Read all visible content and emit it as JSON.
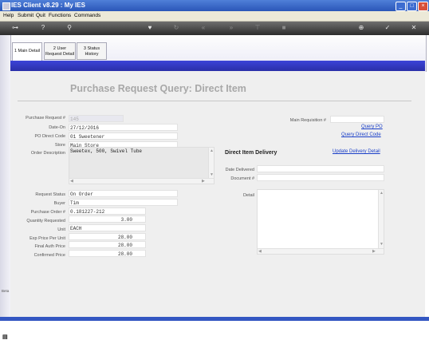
{
  "window": {
    "title": "IES Client v8.29 : My IES"
  },
  "menu": [
    "Help",
    "Submit",
    "Quit",
    "Functions",
    "Commands"
  ],
  "toolbar_icons": [
    "key-icon",
    "help-icon",
    "search-icon",
    "heart-icon",
    "refresh-icon",
    "rewind-icon",
    "fast-forward-icon",
    "filter-icon",
    "stop-icon",
    "add-icon",
    "check-icon",
    "close-icon"
  ],
  "tabs": [
    {
      "label": "1 Main Detail"
    },
    {
      "label": "2 User Request Detail"
    },
    {
      "label": "3 Status History"
    }
  ],
  "page": {
    "title": "Purchase Request Query: Direct Item"
  },
  "form": {
    "purchase_request_label": "Purchase Request #",
    "purchase_request_value": "145",
    "date_on_label": "Date-On",
    "date_on_value": "27/12/2016",
    "po_direct_code_label": "PO Direct Code",
    "po_direct_code_value": "01 Sweetener",
    "store_label": "Store",
    "store_value": "Main Store",
    "order_description_label": "Order Description",
    "order_description_value": "Sweetex, 500, Swivel Tube",
    "request_status_label": "Request Status",
    "request_status_value": "On Order",
    "buyer_label": "Buyer",
    "buyer_value": "Tim",
    "purchase_order_label": "Purchase Order #",
    "purchase_order_value": "0.181227-212",
    "quantity_requested_label": "Quantity Requested",
    "quantity_requested_value": "3.00",
    "unit_label": "Unit",
    "unit_value": "EACH",
    "exp_price_label": "Exp Price Per Unit",
    "exp_price_value": "28.00",
    "final_auth_price_label": "Final Auth Price",
    "final_auth_price_value": "28.00",
    "confirmed_price_label": "Confirmed Price",
    "confirmed_price_value": "28.00"
  },
  "right": {
    "main_requisition_label": "Main Requisition #",
    "main_requisition_value": "",
    "query_po_link": "Query PO",
    "query_direct_code_link": "Query Direct Code",
    "direct_item_delivery_heading": "Direct Item Delivery",
    "update_delivery_detail_link": "Update Delivery Detail",
    "date_delivered_label": "Date Delivered",
    "date_delivered_value": "",
    "document_label": "Document #",
    "document_value": "",
    "detail_label": "Detail"
  },
  "left_rail": {
    "text": "Beta"
  }
}
